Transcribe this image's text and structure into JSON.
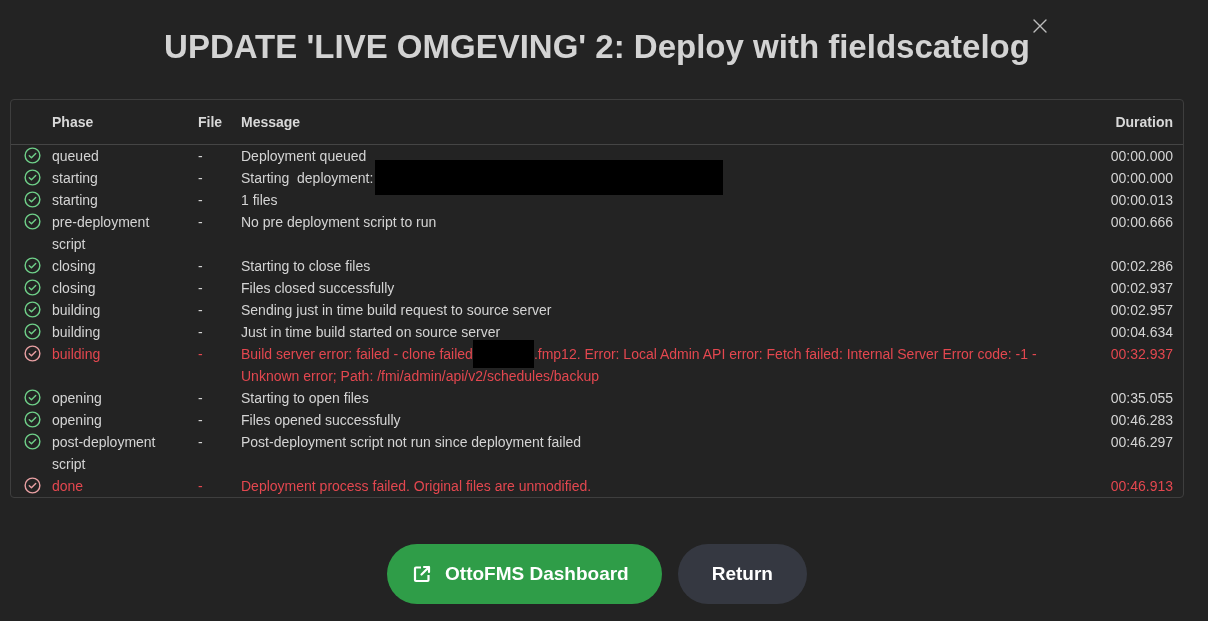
{
  "dialog": {
    "title": "UPDATE 'LIVE OMGEVING' 2: Deploy with fieldscatelog"
  },
  "table": {
    "columns": [
      "Phase",
      "File",
      "Message",
      "Duration"
    ],
    "rows": [
      {
        "failed": false,
        "phase": "queued",
        "file": "-",
        "message": [
          {
            "kind": "text",
            "text": "Deployment queued"
          }
        ],
        "duration": "00:00.000"
      },
      {
        "failed": false,
        "phase": "starting",
        "file": "-",
        "message": [
          {
            "kind": "text",
            "text": "Starting  deployment:"
          },
          {
            "kind": "redacted",
            "wide": true
          }
        ],
        "duration": "00:00.000"
      },
      {
        "failed": false,
        "phase": "starting",
        "file": "-",
        "message": [
          {
            "kind": "text",
            "text": "1 files"
          }
        ],
        "duration": "00:00.013"
      },
      {
        "failed": false,
        "phase": "pre-deployment script",
        "file": "-",
        "message": [
          {
            "kind": "text",
            "text": "No pre deployment script to run"
          }
        ],
        "duration": "00:00.666"
      },
      {
        "failed": false,
        "phase": "closing",
        "file": "-",
        "message": [
          {
            "kind": "text",
            "text": "Starting to close files"
          }
        ],
        "duration": "00:02.286"
      },
      {
        "failed": false,
        "phase": "closing",
        "file": "-",
        "message": [
          {
            "kind": "text",
            "text": "Files closed successfully"
          }
        ],
        "duration": "00:02.937"
      },
      {
        "failed": false,
        "phase": "building",
        "file": "-",
        "message": [
          {
            "kind": "text",
            "text": "Sending just in time build request to source server"
          }
        ],
        "duration": "00:02.957"
      },
      {
        "failed": false,
        "phase": "building",
        "file": "-",
        "message": [
          {
            "kind": "text",
            "text": "Just in time build started on source server"
          }
        ],
        "duration": "00:04.634"
      },
      {
        "failed": true,
        "phase": "building",
        "file": "-",
        "message": [
          {
            "kind": "text",
            "text": "Build server error: failed - clone failed"
          },
          {
            "kind": "redacted",
            "wide": false
          },
          {
            "kind": "text",
            "text": ".fmp12. Error: Local Admin API error: Fetch failed: Internal Server Error code: -1 - Unknown error; Path: /fmi/admin/api/v2/schedules/backup"
          }
        ],
        "duration": "00:32.937"
      },
      {
        "failed": false,
        "phase": "opening",
        "file": "-",
        "message": [
          {
            "kind": "text",
            "text": "Starting to open files"
          }
        ],
        "duration": "00:35.055"
      },
      {
        "failed": false,
        "phase": "opening",
        "file": "-",
        "message": [
          {
            "kind": "text",
            "text": "Files opened successfully"
          }
        ],
        "duration": "00:46.283"
      },
      {
        "failed": false,
        "phase": "post-deployment script",
        "file": "-",
        "message": [
          {
            "kind": "text",
            "text": "Post-deployment script not run since deployment failed"
          }
        ],
        "duration": "00:46.297"
      },
      {
        "failed": true,
        "phase": "done",
        "file": "-",
        "message": [
          {
            "kind": "text",
            "text": "Deployment process failed. Original files are unmodified."
          }
        ],
        "duration": "00:46.913"
      }
    ]
  },
  "buttons": [
    {
      "kind": "external",
      "label": "OttoFMS Dashboard"
    },
    {
      "kind": "plain",
      "label": "Return"
    }
  ]
}
